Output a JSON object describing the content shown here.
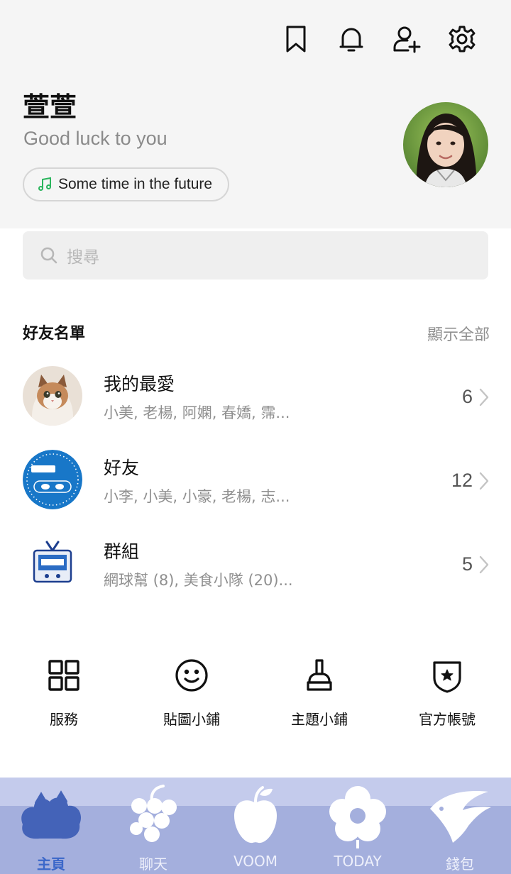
{
  "header": {
    "icons": [
      "bookmark-icon",
      "bell-icon",
      "add-friend-icon",
      "gear-icon"
    ],
    "profile_name": "萱萱",
    "status_message": "Good luck to you",
    "music": "Some time in the future"
  },
  "search": {
    "placeholder": "搜尋"
  },
  "friends_section": {
    "title": "好友名單",
    "show_all": "顯示全部",
    "rows": [
      {
        "title": "我的最愛",
        "subtitle": "小美, 老楊, 阿嫻, 春嬌, 霈...",
        "count": "6"
      },
      {
        "title": "好友",
        "subtitle": "小李, 小美, 小豪, 老楊, 志...",
        "count": "12"
      },
      {
        "title": "群組",
        "subtitle": "網球幫 (8), 美食小隊 (20)...",
        "count": "5"
      }
    ]
  },
  "shortcuts": [
    {
      "label": "服務",
      "icon": "grid-icon"
    },
    {
      "label": "貼圖小鋪",
      "icon": "smiley-icon"
    },
    {
      "label": "主題小鋪",
      "icon": "brush-icon"
    },
    {
      "label": "官方帳號",
      "icon": "shield-star-icon"
    }
  ],
  "bottom_nav": {
    "active": "主頁",
    "items": [
      {
        "label": "主頁",
        "icon": "home-blob-icon"
      },
      {
        "label": "聊天",
        "icon": "grapes-icon"
      },
      {
        "label": "VOOM",
        "icon": "apple-icon"
      },
      {
        "label": "TODAY",
        "icon": "flower-icon"
      },
      {
        "label": "錢包",
        "icon": "fish-icon"
      }
    ]
  },
  "colors": {
    "header_bg": "#f5f5f5",
    "accent_music": "#2bb55d",
    "nav_bg": "#a4afdd",
    "nav_active": "#3b67c9"
  }
}
